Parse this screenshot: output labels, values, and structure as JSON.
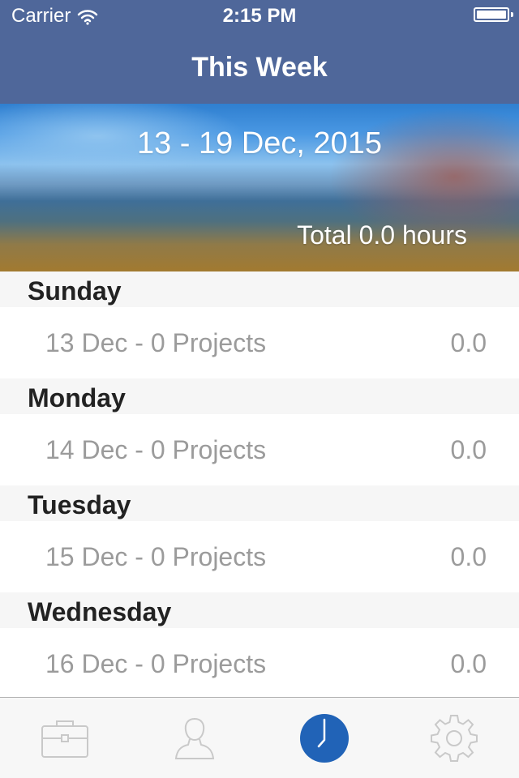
{
  "status_bar": {
    "carrier": "Carrier",
    "time": "2:15 PM",
    "wifi_icon": "wifi-icon",
    "battery_icon": "battery-icon"
  },
  "nav": {
    "title": "This Week"
  },
  "hero": {
    "date_range": "13 - 19 Dec, 2015",
    "total": "Total 0.0 hours"
  },
  "days": [
    {
      "name": "Sunday",
      "label": "13 Dec - 0 Projects",
      "value": "0.0"
    },
    {
      "name": "Monday",
      "label": "14 Dec - 0 Projects",
      "value": "0.0"
    },
    {
      "name": "Tuesday",
      "label": "15 Dec - 0 Projects",
      "value": "0.0"
    },
    {
      "name": "Wednesday",
      "label": "16 Dec - 0 Projects",
      "value": "0.0"
    }
  ],
  "tab_bar": {
    "items": [
      {
        "icon": "briefcase-icon",
        "selected": false
      },
      {
        "icon": "person-icon",
        "selected": false
      },
      {
        "icon": "clock-icon",
        "selected": true
      },
      {
        "icon": "gear-icon",
        "selected": false
      }
    ]
  },
  "colors": {
    "nav_blue": "#4f679a",
    "tab_selected": "#2163b7",
    "tab_unselected": "#c9c9c9",
    "row_text": "#9b9b9b",
    "section_bg": "#f6f6f6"
  }
}
